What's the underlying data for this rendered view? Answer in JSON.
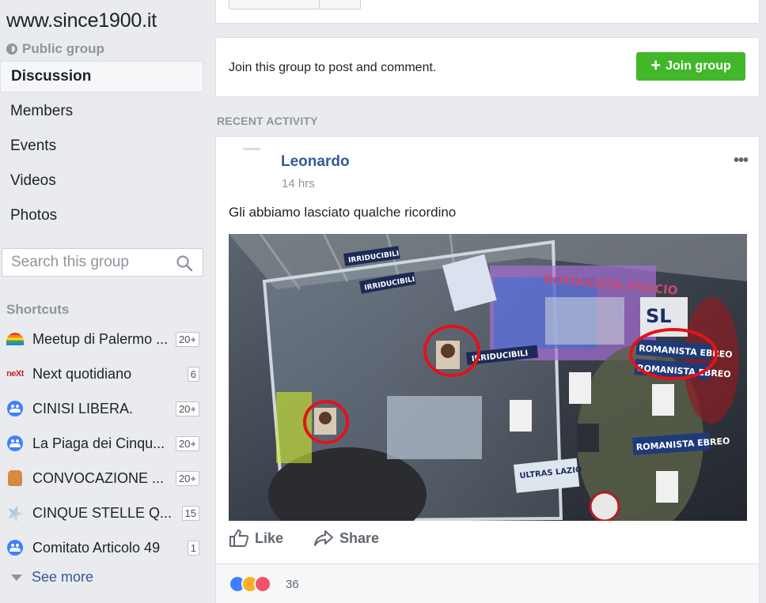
{
  "group": {
    "title": "www.since1900.it",
    "privacy": "Public group"
  },
  "nav": [
    "Discussion",
    "Members",
    "Events",
    "Videos",
    "Photos"
  ],
  "search": {
    "placeholder": "Search this group"
  },
  "shortcuts": {
    "title": "Shortcuts",
    "items": [
      {
        "label": "Meetup di Palermo ...",
        "badge": "20+",
        "icon": "rainbow-icon"
      },
      {
        "label": "Next quotidiano",
        "badge": "6",
        "icon": "next-logo-icon"
      },
      {
        "label": "CINISI LIBERA.",
        "badge": "20+",
        "icon": "group-icon"
      },
      {
        "label": "La Piaga dei Cinqu...",
        "badge": "20+",
        "icon": "group-icon"
      },
      {
        "label": "CONVOCAZIONE ...",
        "badge": "20+",
        "icon": "fist-icon"
      },
      {
        "label": "CINQUE STELLE Q...",
        "badge": "15",
        "icon": "star-icon"
      },
      {
        "label": "Comitato Articolo 49",
        "badge": "1",
        "icon": "group-icon"
      }
    ],
    "see_more": "See more"
  },
  "join": {
    "text": "Join this group to post and comment.",
    "button": "Join group"
  },
  "recent_activity": "RECENT ACTIVITY",
  "post": {
    "author": "Leonardo",
    "time": "14 hrs",
    "text": "Gli abbiamo lasciato qualche ricordino",
    "photo_signs": [
      "IRRIDUCIBILI",
      "IRRIDUCIBILI",
      "ROMANISTA FROCIO",
      "ROMANISTA EBREO",
      "ROMANISTA EBREO",
      "IRRIDUCIBILI",
      "ROMANISTA EBREO",
      "ULTRAS LAZIO",
      "SL"
    ],
    "actions": {
      "like": "Like",
      "share": "Share"
    },
    "reaction_count": "36"
  },
  "colors": {
    "link": "#365899",
    "join_green": "#42b72a",
    "circle_red": "#e3121a"
  }
}
